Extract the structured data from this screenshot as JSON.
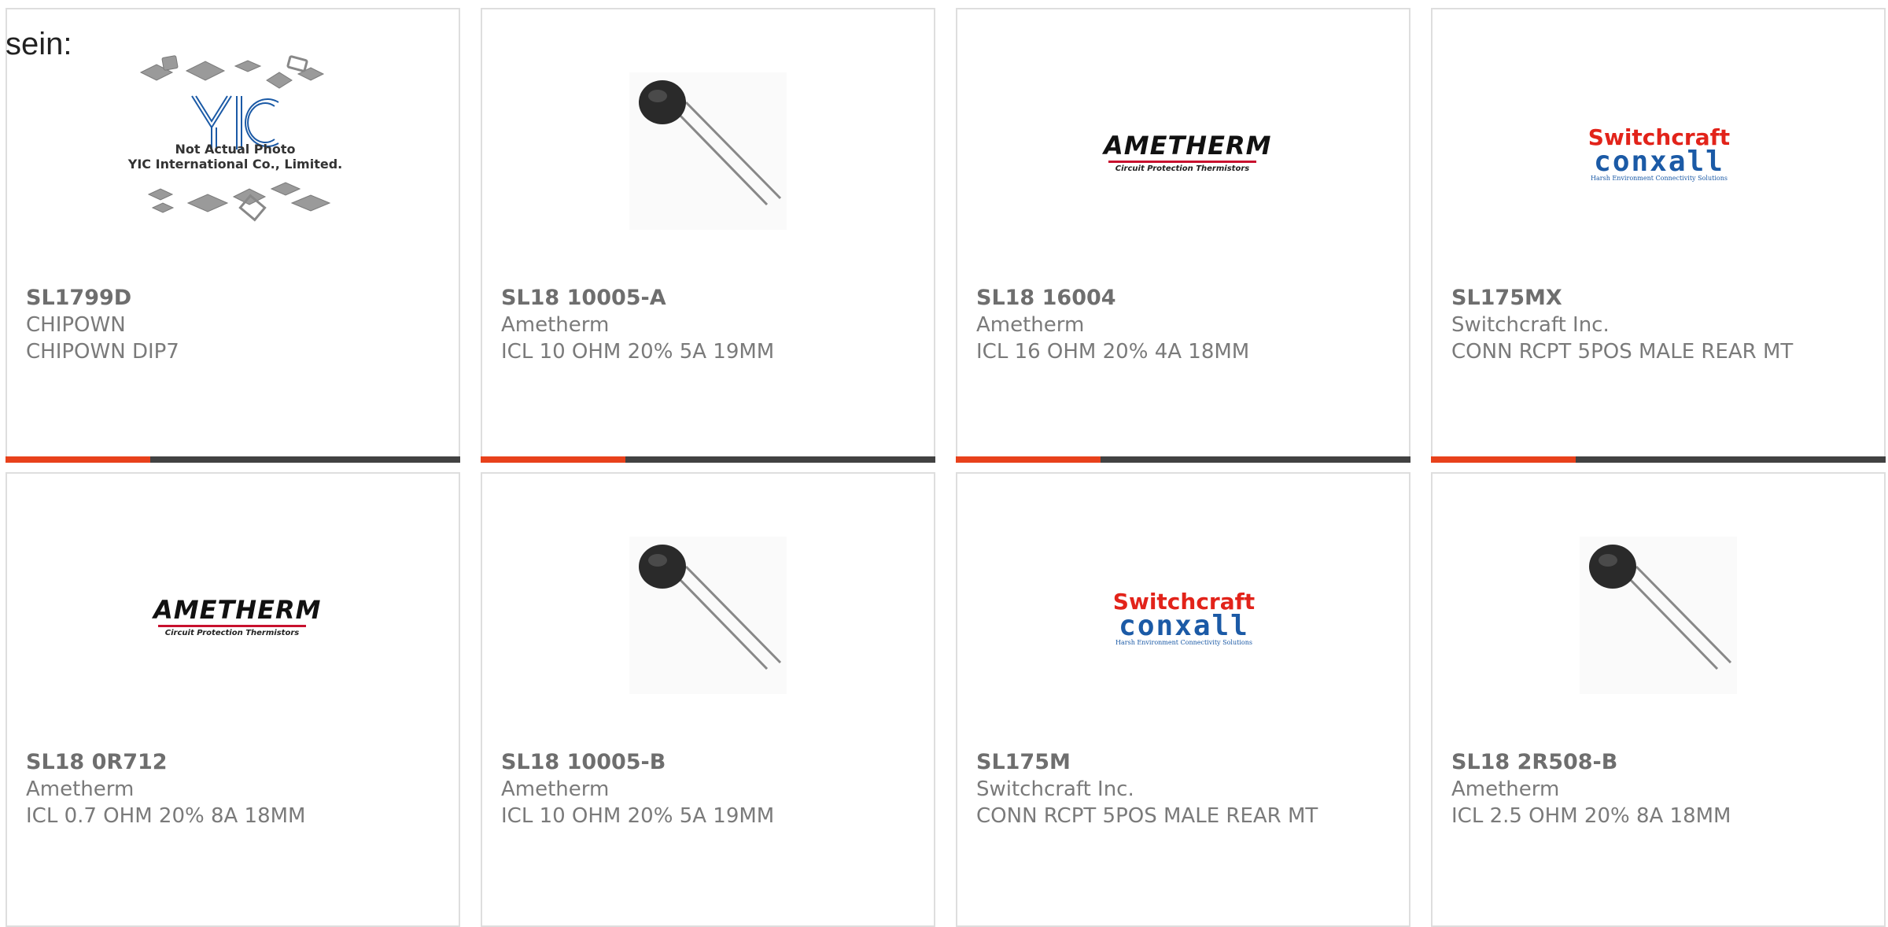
{
  "lead_text": "sein:",
  "products": [
    {
      "part_number": "SL1799D",
      "manufacturer": "CHIPOWN",
      "description": "CHIPOWN DIP7",
      "image": "yic-placeholder",
      "image_text": [
        "Not Actual Photo",
        "YIC International Co., Limited."
      ]
    },
    {
      "part_number": "SL18 10005-A",
      "manufacturer": "Ametherm",
      "description": "ICL 10 OHM 20% 5A 19MM",
      "image": "thermistor-photo"
    },
    {
      "part_number": "SL18 16004",
      "manufacturer": "Ametherm",
      "description": "ICL 16 OHM 20% 4A 18MM",
      "image": "ametherm-logo",
      "logo_text": [
        "AMETHERM",
        "Circuit Protection Thermistors"
      ]
    },
    {
      "part_number": "SL175MX",
      "manufacturer": "Switchcraft Inc.",
      "description": "CONN RCPT 5POS MALE REAR MT",
      "image": "switchcraft-logo",
      "logo_text": [
        "Switchcraft",
        "conxall",
        "Harsh Environment Connectivity Solutions"
      ]
    },
    {
      "part_number": "SL18 0R712",
      "manufacturer": "Ametherm",
      "description": "ICL 0.7 OHM 20% 8A 18MM",
      "image": "ametherm-logo",
      "logo_text": [
        "AMETHERM",
        "Circuit Protection Thermistors"
      ]
    },
    {
      "part_number": "SL18 10005-B",
      "manufacturer": "Ametherm",
      "description": "ICL 10 OHM 20% 5A 19MM",
      "image": "thermistor-photo"
    },
    {
      "part_number": "SL175M",
      "manufacturer": "Switchcraft Inc.",
      "description": "CONN RCPT 5POS MALE REAR MT",
      "image": "switchcraft-logo",
      "logo_text": [
        "Switchcraft",
        "conxall",
        "Harsh Environment Connectivity Solutions"
      ]
    },
    {
      "part_number": "SL18 2R508-B",
      "manufacturer": "Ametherm",
      "description": "ICL 2.5 OHM 20% 8A 18MM",
      "image": "thermistor-photo"
    }
  ],
  "colors": {
    "accent": "#e8411b",
    "bar": "#424242",
    "border": "#dedede",
    "text": "#6e6e6e"
  }
}
